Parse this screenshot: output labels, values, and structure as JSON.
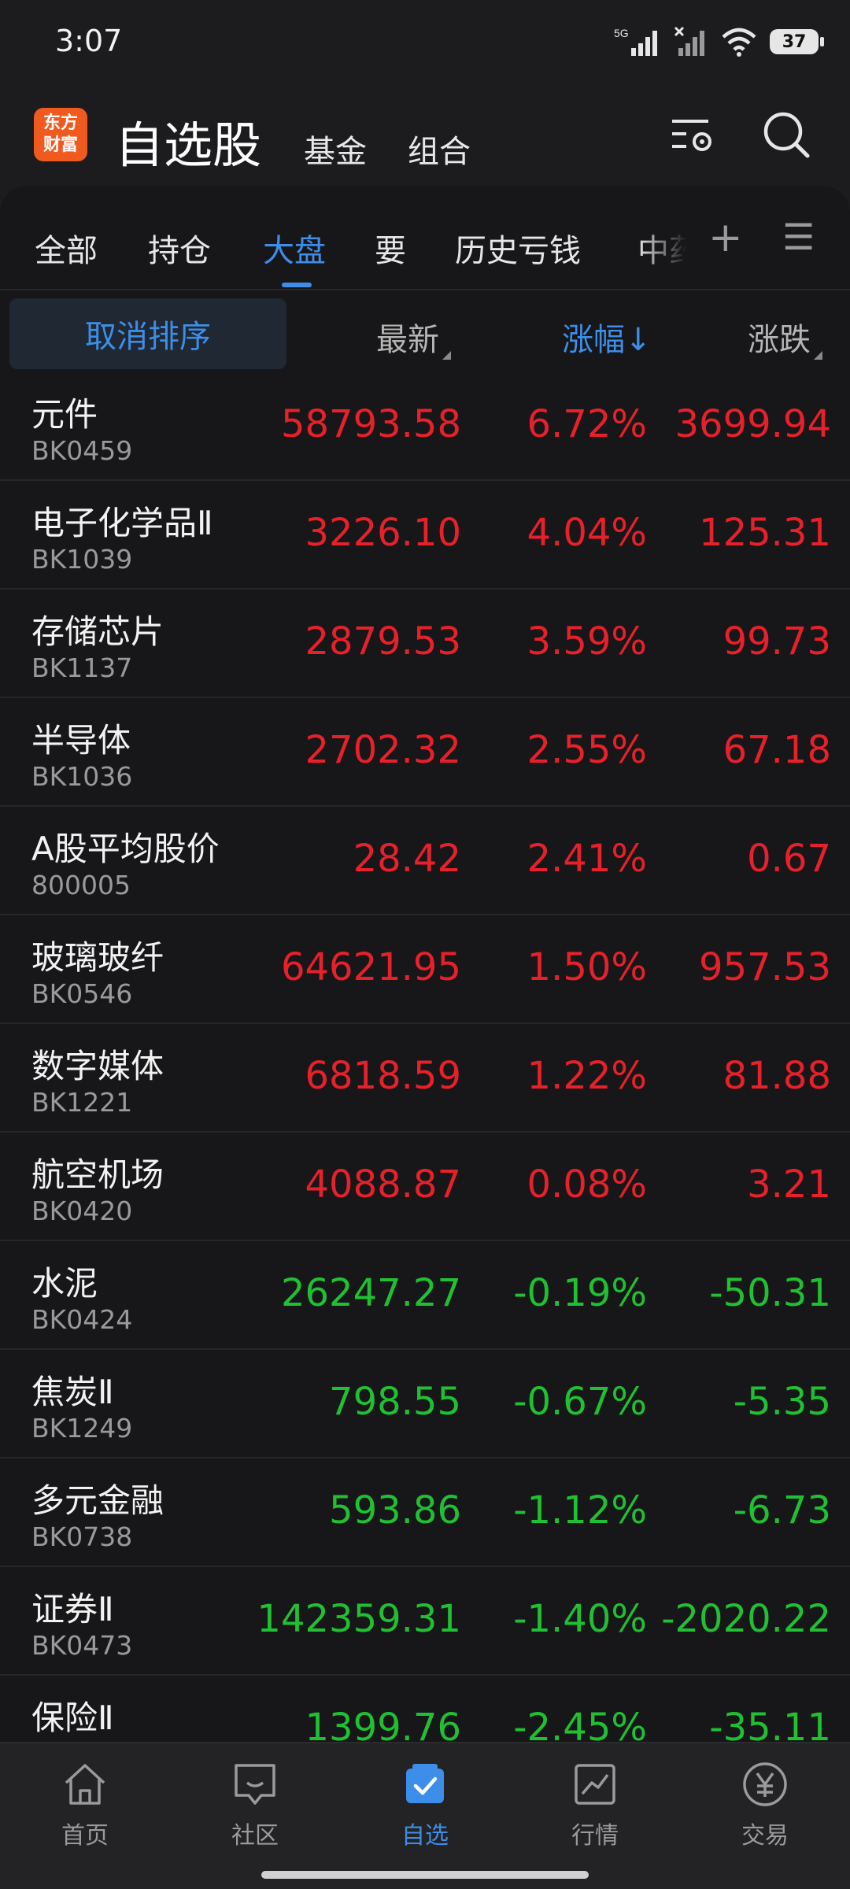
{
  "status": {
    "time": "3:07",
    "network": "5G",
    "battery": "37"
  },
  "header": {
    "logo_line1": "东方",
    "logo_line2": "财富",
    "title": "自选股",
    "sub1": "基金",
    "sub2": "组合",
    "icons": [
      "settings-list-icon",
      "search-icon"
    ]
  },
  "tabs": [
    "全部",
    "持仓",
    "大盘",
    "要",
    "历史亏钱",
    "中药"
  ],
  "active_tab": "大盘",
  "sort_header": {
    "cancel": "取消排序",
    "col_price": "最新",
    "col_pct": "涨幅",
    "col_pct_arrow": "↓",
    "col_chg": "涨跌"
  },
  "rows": [
    {
      "name": "元件",
      "code": "BK0459",
      "price": "58793.58",
      "pct": "6.72%",
      "chg": "3699.94",
      "dir": "up"
    },
    {
      "name": "电子化学品Ⅱ",
      "code": "BK1039",
      "price": "3226.10",
      "pct": "4.04%",
      "chg": "125.31",
      "dir": "up"
    },
    {
      "name": "存储芯片",
      "code": "BK1137",
      "price": "2879.53",
      "pct": "3.59%",
      "chg": "99.73",
      "dir": "up"
    },
    {
      "name": "半导体",
      "code": "BK1036",
      "price": "2702.32",
      "pct": "2.55%",
      "chg": "67.18",
      "dir": "up"
    },
    {
      "name": "A股平均股价",
      "code": "800005",
      "price": "28.42",
      "pct": "2.41%",
      "chg": "0.67",
      "dir": "up"
    },
    {
      "name": "玻璃玻纤",
      "code": "BK0546",
      "price": "64621.95",
      "pct": "1.50%",
      "chg": "957.53",
      "dir": "up"
    },
    {
      "name": "数字媒体",
      "code": "BK1221",
      "price": "6818.59",
      "pct": "1.22%",
      "chg": "81.88",
      "dir": "up"
    },
    {
      "name": "航空机场",
      "code": "BK0420",
      "price": "4088.87",
      "pct": "0.08%",
      "chg": "3.21",
      "dir": "up"
    },
    {
      "name": "水泥",
      "code": "BK0424",
      "price": "26247.27",
      "pct": "-0.19%",
      "chg": "-50.31",
      "dir": "down"
    },
    {
      "name": "焦炭Ⅱ",
      "code": "BK1249",
      "price": "798.55",
      "pct": "-0.67%",
      "chg": "-5.35",
      "dir": "down"
    },
    {
      "name": "多元金融",
      "code": "BK0738",
      "price": "593.86",
      "pct": "-1.12%",
      "chg": "-6.73",
      "dir": "down"
    },
    {
      "name": "证券Ⅱ",
      "code": "BK0473",
      "price": "142359.31",
      "pct": "-1.40%",
      "chg": "-2020.22",
      "dir": "down"
    },
    {
      "name": "保险Ⅱ",
      "code": "",
      "price": "1399.76",
      "pct": "-2.45%",
      "chg": "-35.11",
      "dir": "down"
    }
  ],
  "colors": {
    "up": "#e8202a",
    "down": "#1fc132",
    "accent": "#3d8ee8",
    "logo": "#f05a1e"
  },
  "bottom_nav": [
    {
      "label": "首页",
      "icon": "home-icon"
    },
    {
      "label": "社区",
      "icon": "community-icon"
    },
    {
      "label": "自选",
      "icon": "watchlist-icon"
    },
    {
      "label": "行情",
      "icon": "market-chart-icon"
    },
    {
      "label": "交易",
      "icon": "yuan-trade-icon"
    }
  ],
  "active_nav": "自选"
}
